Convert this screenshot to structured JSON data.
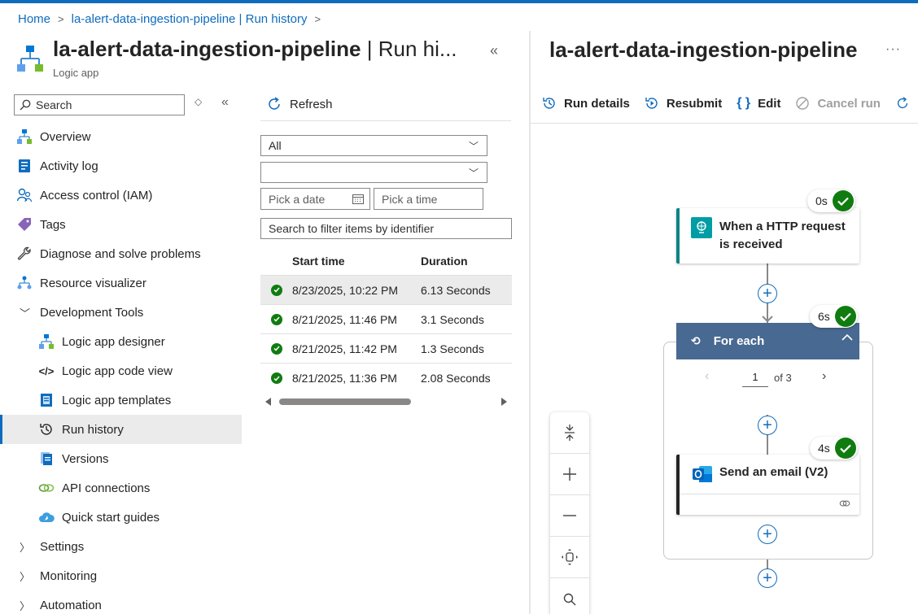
{
  "colors": {
    "accent": "#0f6cbd",
    "success": "#107c10",
    "foreach_header": "#486991"
  },
  "breadcrumb": {
    "home": "Home",
    "current": "la-alert-data-ingestion-pipeline | Run history"
  },
  "header": {
    "title_main": "la-alert-data-ingestion-pipeline",
    "title_suffix": " | Run hi...",
    "subtitle": "Logic app"
  },
  "search": {
    "placeholder": "Search"
  },
  "sidebar": {
    "items": [
      {
        "label": "Overview",
        "icon": "overview-icon"
      },
      {
        "label": "Activity log",
        "icon": "activity-log-icon"
      },
      {
        "label": "Access control (IAM)",
        "icon": "iam-icon"
      },
      {
        "label": "Tags",
        "icon": "tag-icon"
      },
      {
        "label": "Diagnose and solve problems",
        "icon": "wrench-icon"
      },
      {
        "label": "Resource visualizer",
        "icon": "visualizer-icon"
      },
      {
        "label": "Development Tools",
        "icon": "chevron-down-icon"
      },
      {
        "label": "Logic app designer",
        "icon": "designer-icon"
      },
      {
        "label": "Logic app code view",
        "icon": "code-icon"
      },
      {
        "label": "Logic app templates",
        "icon": "templates-icon"
      },
      {
        "label": "Run history",
        "icon": "history-icon"
      },
      {
        "label": "Versions",
        "icon": "versions-icon"
      },
      {
        "label": "API connections",
        "icon": "api-connections-icon"
      },
      {
        "label": "Quick start guides",
        "icon": "quickstart-icon"
      },
      {
        "label": "Settings",
        "icon": "chevron-right-icon"
      },
      {
        "label": "Monitoring",
        "icon": "chevron-right-icon"
      },
      {
        "label": "Automation",
        "icon": "chevron-right-icon"
      }
    ]
  },
  "runs": {
    "refresh_label": "Refresh",
    "status_filter": "All",
    "filter2_value": "",
    "date_placeholder": "Pick a date",
    "time_placeholder": "Pick a time",
    "id_search_placeholder": "Search to filter items by identifier",
    "columns": {
      "start": "Start time",
      "duration": "Duration"
    },
    "rows": [
      {
        "start": "8/23/2025, 10:22 PM",
        "duration": "6.13 Seconds",
        "status": "succeeded"
      },
      {
        "start": "8/21/2025, 11:46 PM",
        "duration": "3.1 Seconds",
        "status": "succeeded"
      },
      {
        "start": "8/21/2025, 11:42 PM",
        "duration": "1.3 Seconds",
        "status": "succeeded"
      },
      {
        "start": "8/21/2025, 11:36 PM",
        "duration": "2.08 Seconds",
        "status": "succeeded"
      }
    ]
  },
  "detail": {
    "title": "la-alert-data-ingestion-pipeline",
    "toolbar": {
      "run_details": "Run details",
      "resubmit": "Resubmit",
      "edit": "Edit",
      "cancel_run": "Cancel run",
      "refresh_truncated": "R"
    },
    "trigger": {
      "label": "When a HTTP request is received",
      "duration": "0s"
    },
    "foreach": {
      "label": "For each",
      "duration": "6s",
      "page": "1",
      "page_of": "of 3"
    },
    "email": {
      "label": "Send an email (V2)",
      "duration": "4s"
    }
  }
}
